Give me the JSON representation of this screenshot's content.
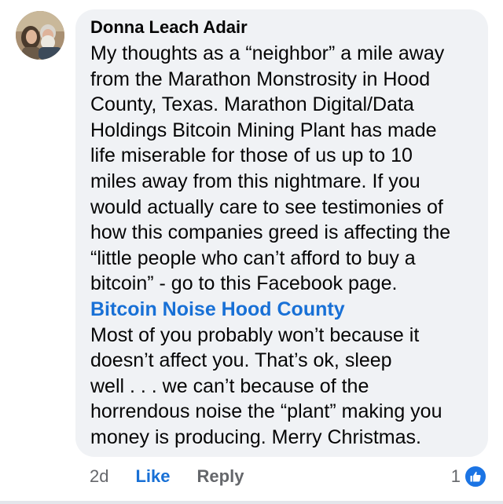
{
  "comment": {
    "author": "Donna Leach Adair",
    "text_lines_1": [
      "My thoughts as a “neighbor” a mile away",
      "from the Marathon Monstrosity in Hood",
      "County, Texas. Marathon Digital/Data",
      "Holdings Bitcoin Mining Plant has made",
      "life miserable for those of us up to 10",
      "miles away from this nightmare. If you",
      "would actually care to see testimonies of",
      "how this companies greed is affecting the",
      "“little people who can’t afford to buy a",
      "bitcoin” - go to this Facebook page."
    ],
    "link_text": "Bitcoin Noise Hood County",
    "text_lines_2": [
      "Most of you probably won’t because it",
      "doesn’t affect you. That’s ok, sleep",
      "well . . . we can’t because of the",
      "horrendous noise the “plant” making you",
      "money is producing. Merry Christmas."
    ]
  },
  "actions": {
    "time": "2d",
    "like_label": "Like",
    "reply_label": "Reply"
  },
  "reactions": {
    "count": "1",
    "icon": "thumbs-up-icon"
  },
  "colors": {
    "bubble": "#f0f2f5",
    "link": "#1870d6",
    "like_badge": "#1b74e4",
    "muted": "#65676b"
  }
}
